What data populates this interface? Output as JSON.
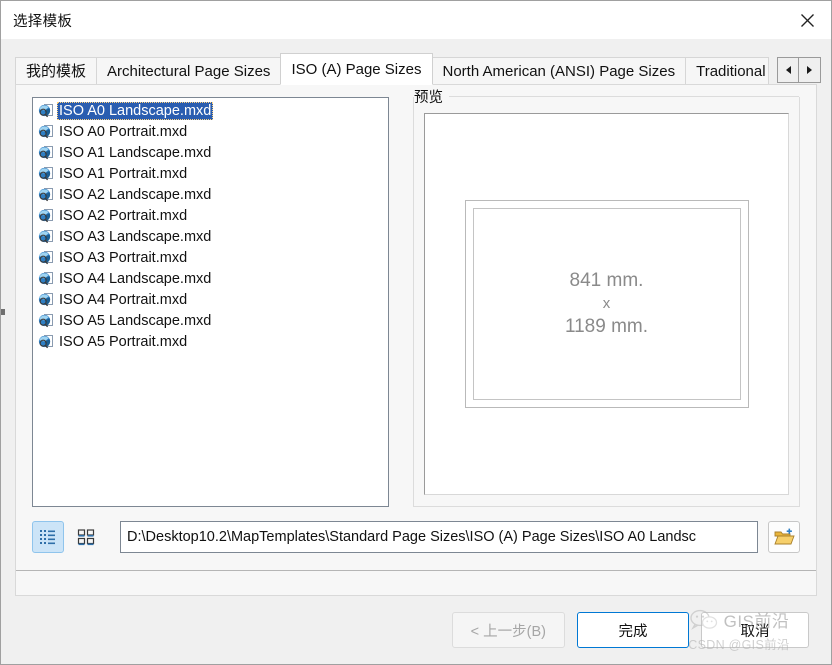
{
  "window": {
    "title": "选择模板",
    "close_label": "✕"
  },
  "tabs": {
    "items": [
      {
        "label": "我的模板",
        "active": false
      },
      {
        "label": "Architectural Page Sizes",
        "active": false
      },
      {
        "label": "ISO (A) Page Sizes",
        "active": true
      },
      {
        "label": "North American (ANSI) Page Sizes",
        "active": false
      },
      {
        "label": "Traditional I",
        "active": false
      }
    ],
    "scroll_left_icon": "triangle-left-icon",
    "scroll_right_icon": "triangle-right-icon"
  },
  "file_list": {
    "items": [
      {
        "name": "ISO A0 Landscape.mxd",
        "selected": true
      },
      {
        "name": "ISO A0 Portrait.mxd",
        "selected": false
      },
      {
        "name": "ISO A1 Landscape.mxd",
        "selected": false
      },
      {
        "name": "ISO A1 Portrait.mxd",
        "selected": false
      },
      {
        "name": "ISO A2 Landscape.mxd",
        "selected": false
      },
      {
        "name": "ISO A2 Portrait.mxd",
        "selected": false
      },
      {
        "name": "ISO A3 Landscape.mxd",
        "selected": false
      },
      {
        "name": "ISO A3 Portrait.mxd",
        "selected": false
      },
      {
        "name": "ISO A4 Landscape.mxd",
        "selected": false
      },
      {
        "name": "ISO A4 Portrait.mxd",
        "selected": false
      },
      {
        "name": "ISO A5 Landscape.mxd",
        "selected": false
      },
      {
        "name": "ISO A5 Portrait.mxd",
        "selected": false
      }
    ]
  },
  "preview": {
    "legend": "预览",
    "width_text": "841 mm.",
    "separator_text": "x",
    "height_text": "1189 mm."
  },
  "path_row": {
    "view_mode_list_icon": "list-view-icon",
    "view_mode_icons_icon": "large-icons-view-icon",
    "path_value": "D:\\Desktop10.2\\MapTemplates\\Standard Page Sizes\\ISO (A) Page Sizes\\ISO A0 Landsc",
    "browse_icon": "open-folder-add-icon"
  },
  "footer": {
    "back_label": "< 上一步(B)",
    "finish_label": "完成",
    "cancel_label": "取消"
  },
  "watermark": {
    "title": "GIS前沿",
    "subtitle": "CSDN @GIS前沿",
    "icon": "wechat-icon"
  },
  "colors": {
    "selection_blue": "#2a5db0",
    "accent_blue": "#0078d4",
    "toggle_active_bg": "#cce4f7",
    "dialog_bg": "#f0f0f0"
  }
}
